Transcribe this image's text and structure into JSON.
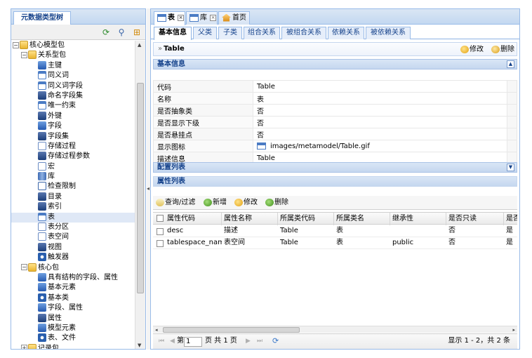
{
  "left": {
    "tab_title": "元数据类型树",
    "tree": [
      {
        "label": "核心模型包",
        "indent": 0,
        "icon": "folder-icon",
        "toggle": "−"
      },
      {
        "label": "关系型包",
        "indent": 1,
        "icon": "folder-icon",
        "toggle": "−"
      },
      {
        "label": "主键",
        "indent": 2,
        "icon": "key-icon"
      },
      {
        "label": "同义词",
        "indent": 2,
        "icon": "synonym-icon"
      },
      {
        "label": "同义词字段",
        "indent": 2,
        "icon": "synonym-field-icon"
      },
      {
        "label": "命名字段集",
        "indent": 2,
        "icon": "field-set-icon",
        "selected": true
      },
      {
        "label": "唯一约束",
        "indent": 2,
        "icon": "unique-constraint-icon"
      },
      {
        "label": "外键",
        "indent": 2,
        "icon": "foreign-key-icon"
      },
      {
        "label": "字段",
        "indent": 2,
        "icon": "field-icon"
      },
      {
        "label": "字段集",
        "indent": 2,
        "icon": "field-set-icon"
      },
      {
        "label": "存储过程",
        "indent": 2,
        "icon": "procedure-icon"
      },
      {
        "label": "存储过程参数",
        "indent": 2,
        "icon": "procedure-param-icon"
      },
      {
        "label": "宏",
        "indent": 2,
        "icon": "macro-icon"
      },
      {
        "label": "库",
        "indent": 2,
        "icon": "database-icon"
      },
      {
        "label": "检查限制",
        "indent": 2,
        "icon": "check-constraint-icon"
      },
      {
        "label": "目录",
        "indent": 2,
        "icon": "catalog-icon"
      },
      {
        "label": "索引",
        "indent": 2,
        "icon": "index-icon"
      },
      {
        "label": "表",
        "indent": 2,
        "icon": "table-icon",
        "selected": true
      },
      {
        "label": "表分区",
        "indent": 2,
        "icon": "partition-icon"
      },
      {
        "label": "表空间",
        "indent": 2,
        "icon": "tablespace-icon"
      },
      {
        "label": "视图",
        "indent": 2,
        "icon": "view-icon"
      },
      {
        "label": "触发器",
        "indent": 2,
        "icon": "trigger-icon"
      },
      {
        "label": "核心包",
        "indent": 1,
        "icon": "folder-icon",
        "toggle": "−"
      },
      {
        "label": "具有结构的字段、属性",
        "indent": 2,
        "icon": "structure-icon"
      },
      {
        "label": "基本元素",
        "indent": 2,
        "icon": "element-icon"
      },
      {
        "label": "基本类",
        "indent": 2,
        "icon": "class-icon"
      },
      {
        "label": "字段、属性",
        "indent": 2,
        "icon": "attribute-icon"
      },
      {
        "label": "属性",
        "indent": 2,
        "icon": "property-icon"
      },
      {
        "label": "模型元素",
        "indent": 2,
        "icon": "model-element-icon"
      },
      {
        "label": "表、文件",
        "indent": 2,
        "icon": "table-file-icon"
      },
      {
        "label": "记录包",
        "indent": 1,
        "icon": "folder-icon",
        "toggle": "+"
      }
    ]
  },
  "tabs": [
    {
      "label": "表",
      "icon": "table-icon",
      "closable": true,
      "active": true
    },
    {
      "label": "库",
      "icon": "table-icon",
      "closable": true,
      "active": false
    },
    {
      "label": "首页",
      "icon": "home-icon",
      "closable": false,
      "active": false
    }
  ],
  "subtabs": [
    "基本信息",
    "父类",
    "子类",
    "组合关系",
    "被组合关系",
    "依赖关系",
    "被依赖关系"
  ],
  "panel": {
    "title": "Table",
    "edit_label": "修改",
    "delete_label": "删除"
  },
  "basic_info": {
    "header": "基本信息",
    "rows": [
      {
        "key": "代码",
        "value": "Table"
      },
      {
        "key": "名称",
        "value": "表"
      },
      {
        "key": "是否抽象类",
        "value": "否"
      },
      {
        "key": "是否显示下级",
        "value": "否"
      },
      {
        "key": "是否悬挂点",
        "value": "否"
      },
      {
        "key": "显示图标",
        "value": "images/metamodel/Table.gif",
        "icon": true
      },
      {
        "key": "描述信息",
        "value": "Table"
      }
    ]
  },
  "config_list": {
    "header": "配置列表"
  },
  "attr_list": {
    "header": "属性列表",
    "toolbar": {
      "query": "查询/过滤",
      "add": "新增",
      "edit": "修改",
      "delete": "删除"
    },
    "columns": [
      "属性代码",
      "属性名称",
      "所属类代码",
      "所属类名",
      "继承性",
      "是否只读",
      "是否"
    ],
    "rows": [
      [
        "desc",
        "描述",
        "Table",
        "表",
        "",
        "否",
        "是"
      ],
      [
        "tablespace_name",
        "表空间",
        "Table",
        "表",
        "public",
        "否",
        "是"
      ]
    ]
  },
  "pager": {
    "page_prefix": "第",
    "page_value": "1",
    "page_suffix": "页 共 1 页",
    "display": "显示 1 - 2，共 2 条"
  }
}
